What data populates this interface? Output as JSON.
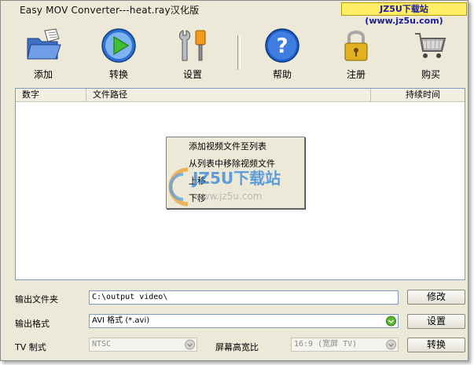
{
  "window": {
    "title": "Easy MOV Converter---heat.ray汉化版"
  },
  "watermark": {
    "badge": "JZ5U下载站(www.jz5u.com)",
    "brand": "JZ5U下载站",
    "url": "www.jz5u.com"
  },
  "toolbar": {
    "add": "添加",
    "convert": "转换",
    "settings": "设置",
    "help": "帮助",
    "register": "注册",
    "buy": "购买"
  },
  "file_list": {
    "columns": [
      "数字",
      "文件路径",
      "持续时间"
    ]
  },
  "context_menu": {
    "items": [
      "添加视频文件至列表",
      "从列表中移除视频文件",
      "上移",
      "下移"
    ]
  },
  "form": {
    "output_folder_label": "输出文件夹",
    "output_folder_value": "C:\\output video\\",
    "modify_button": "修改",
    "output_format_label": "输出格式",
    "output_format_value": "AVI 格式 (*.avi)",
    "format_settings_button": "设置",
    "tv_label": "TV 制式",
    "tv_value": "NTSC",
    "aspect_label": "屏幕高宽比",
    "aspect_value": "16:9  (宽屏 TV)",
    "convert_button": "转换"
  },
  "colors": {
    "accent_green": "#5cb82e",
    "help_blue": "#1f5fc8",
    "lock_gold": "#e2b020"
  }
}
